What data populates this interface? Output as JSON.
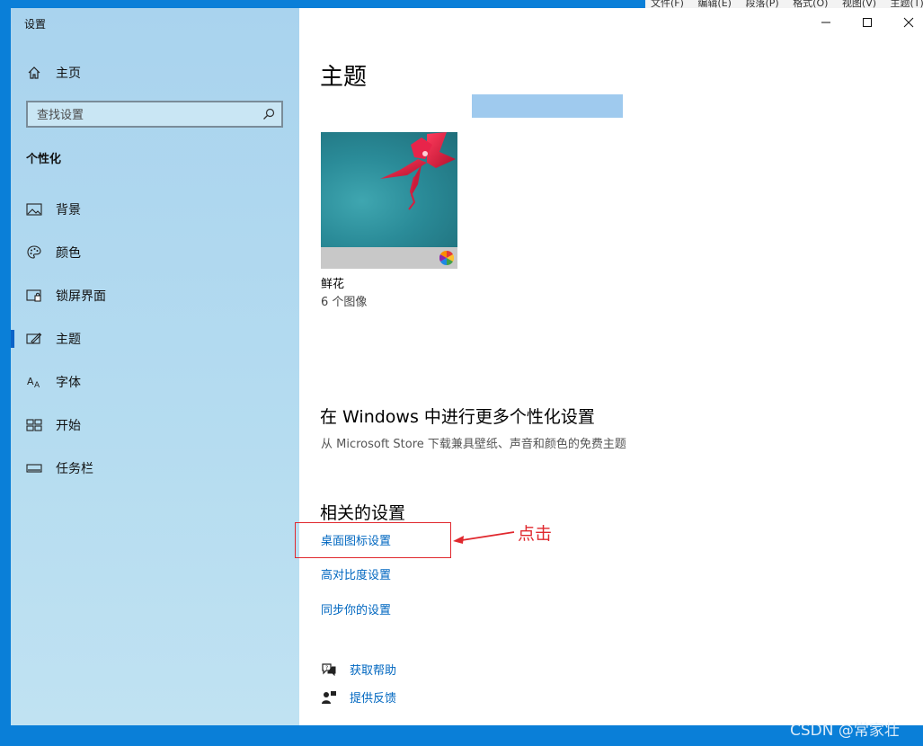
{
  "background_menu": [
    "文件(F)",
    "编辑(E)",
    "段落(P)",
    "格式(O)",
    "视图(V)",
    "主题(T)"
  ],
  "window": {
    "title": "设置"
  },
  "sidebar": {
    "home_label": "主页",
    "search": {
      "placeholder": "查找设置"
    },
    "section": "个性化",
    "items": [
      {
        "label": "背景",
        "icon": "image-icon"
      },
      {
        "label": "颜色",
        "icon": "palette-icon"
      },
      {
        "label": "锁屏界面",
        "icon": "lock-screen-icon"
      },
      {
        "label": "主题",
        "icon": "theme-icon",
        "active": true
      },
      {
        "label": "字体",
        "icon": "font-icon"
      },
      {
        "label": "开始",
        "icon": "start-icon"
      },
      {
        "label": "任务栏",
        "icon": "taskbar-icon"
      }
    ]
  },
  "main": {
    "title": "主题",
    "theme": {
      "name": "鲜花",
      "count": "6 个图像"
    },
    "more_section": {
      "heading": "在 Windows 中进行更多个性化设置",
      "description": "从 Microsoft Store 下载兼具壁纸、声音和颜色的免费主题"
    },
    "related": {
      "heading": "相关的设置",
      "links": [
        "桌面图标设置",
        "高对比度设置",
        "同步你的设置"
      ]
    },
    "help": {
      "get_help": "获取帮助",
      "feedback": "提供反馈"
    }
  },
  "annotation": {
    "text": "点击",
    "color": "#e0282e"
  },
  "watermark": "CSDN @常家壮",
  "colors": {
    "accent": "#0067c0",
    "sidebar": "#b5dcf0",
    "desktop": "#0a7fd8"
  }
}
